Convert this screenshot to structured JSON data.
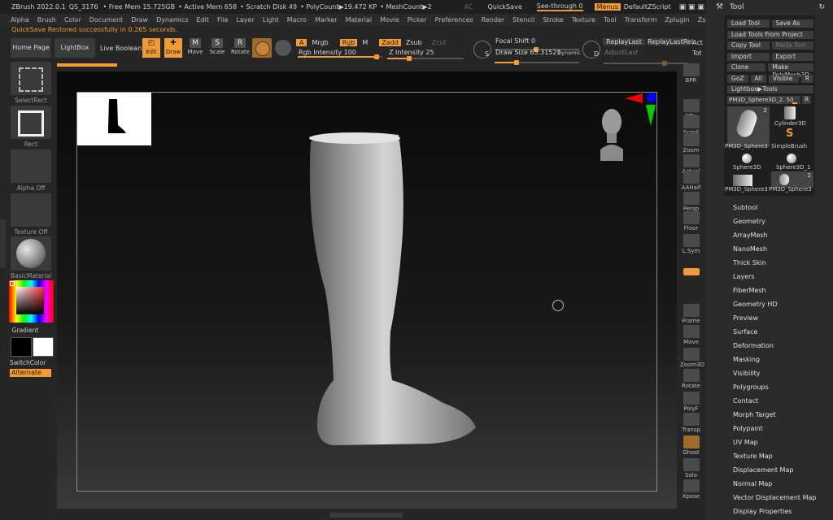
{
  "titlebar": {
    "app": "ZBrush 2022.0.1",
    "file": "QS_3176",
    "free_mem": "• Free Mem 15.725GB",
    "active_mem": "• Active Mem 658",
    "scratch": "• Scratch Disk 49",
    "poly": "• PolyCount▶19.472 KP",
    "mesh": "• MeshCount▶2",
    "ac": "AC",
    "quicksave": "QuickSave",
    "seethrough": "See-through 0",
    "menus": "Menus",
    "defaultzscript": "DefaultZScript"
  },
  "menus": [
    "Alpha",
    "Brush",
    "Color",
    "Document",
    "Draw",
    "Dynamics",
    "Edit",
    "File",
    "Layer",
    "Light",
    "Macro",
    "Marker",
    "Material",
    "Movie",
    "Picker",
    "Preferences",
    "Render",
    "Stencil",
    "Stroke",
    "Texture",
    "Tool",
    "Transform",
    "Zplugin",
    "Zscript",
    "Help"
  ],
  "status": "QuickSave Restored successfully in 0.265 seconds.",
  "toolbar": {
    "home": "Home Page",
    "lightbox": "LightBox",
    "liveboolean": "Live Boolean",
    "edit": "Edit",
    "draw": "Draw",
    "move": "Move",
    "scale": "Scale",
    "rotate": "Rotate",
    "a": "A",
    "mrgb": "Mrgb",
    "rgb": "Rgb",
    "m": "M",
    "zadd": "Zadd",
    "zsub": "Zsub",
    "zcut": "Zcut",
    "rgb_intensity": "Rgb Intensity 100",
    "z_intensity": "Z Intensity 25",
    "focal_shift": "Focal Shift 0",
    "draw_size": "Draw Size 65.31521",
    "dynamic": "Dynamic",
    "s": "S",
    "d": "D",
    "replaylast": "ReplayLast",
    "replaylastrel": "ReplayLastRel",
    "adjustlast": "AdjustLast",
    "act": "Act",
    "tot": "Tot",
    "progress_fraction": 0.14
  },
  "leftpanel": {
    "selectrect": "SelectRect",
    "rect": "Rect",
    "alpha": "Alpha Off",
    "texture": "Texture Off",
    "material": "BasicMaterial",
    "gradient": "Gradient",
    "switchcolor": "SwitchColor",
    "alternate": "Alternate"
  },
  "righttray": [
    "BPR",
    "SPix",
    "Scroll",
    "Zoom",
    "Actual",
    "AAHalf",
    "Persp",
    "Floor",
    "L.Sym",
    "",
    "Frame",
    "Move",
    "Zoom3D",
    "Rotate",
    "PolyF",
    "Transp",
    "Ghost",
    "Solo",
    "Xpose"
  ],
  "righttray_top_label": "SPix 3",
  "tool": {
    "title": "Tool",
    "buttons": [
      [
        "Load Tool",
        "Save As"
      ],
      [
        "Load Tools From Project"
      ],
      [
        "Copy Tool",
        "Paste Tool"
      ],
      [
        "Import",
        "Export"
      ],
      [
        "Clone",
        "Make PolyMesh3D"
      ],
      [
        "GoZ",
        "All",
        "Visible",
        "R"
      ],
      [
        "Lightbox▶Tools"
      ]
    ],
    "current": "PM3D_Sphere3D_2. 50",
    "r": "R",
    "thumbs": [
      "PM3D_Sphere3",
      "Cylinder3D",
      "SimpleBrush",
      "Sphere3D",
      "Sphere3D_1",
      "PM3D_Sphere3",
      "PM3D_Sphere3"
    ],
    "thumb_counts": [
      "2",
      "2"
    ],
    "sections": [
      "Subtool",
      "Geometry",
      "ArrayMesh",
      "NanoMesh",
      "Thick Skin",
      "Layers",
      "FiberMesh",
      "Geometry HD",
      "Preview",
      "Surface",
      "Deformation",
      "Masking",
      "Visibility",
      "Polygroups",
      "Contact",
      "Morph Target",
      "Polypaint",
      "UV Map",
      "Texture Map",
      "Displacement Map",
      "Normal Map",
      "Vector Displacement Map",
      "Display Properties"
    ]
  },
  "colors": {
    "accent": "#f29a33",
    "bg": "#262626",
    "panel": "#2b2b2b"
  }
}
